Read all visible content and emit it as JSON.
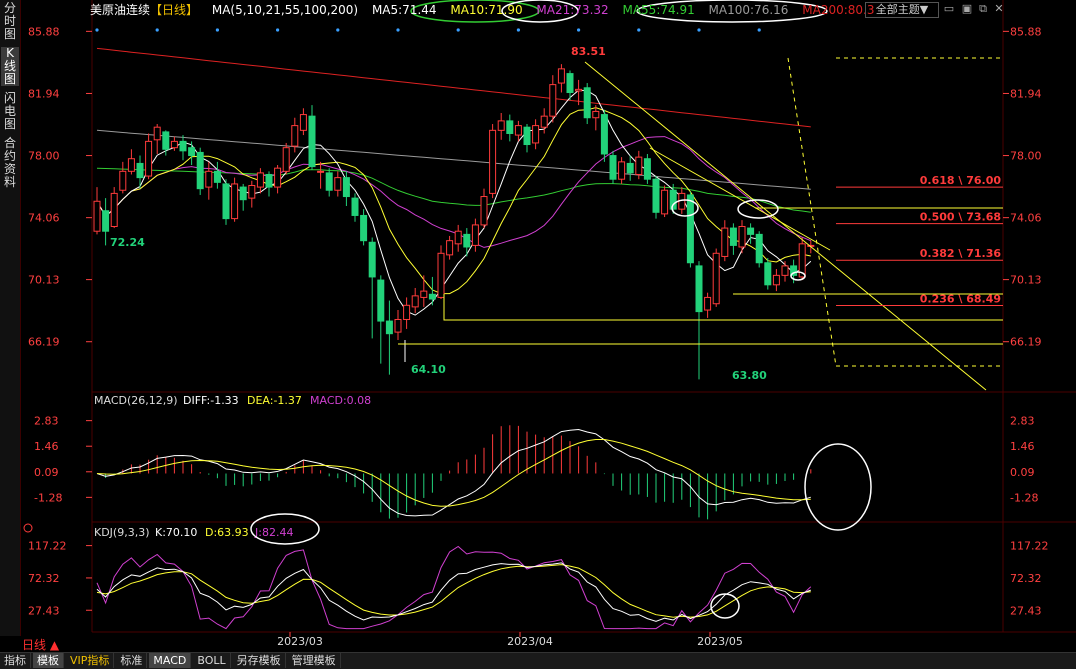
{
  "sidebar": {
    "items": [
      {
        "label": "分时图",
        "active": false
      },
      {
        "label": "K线图",
        "active": true
      },
      {
        "label": "闪电图",
        "active": false
      },
      {
        "label": "合约资料",
        "active": false
      }
    ]
  },
  "header": {
    "title": "美原油连续",
    "period_tag": "【日线】",
    "ma_label": "MA(5,10,21,55,100,200)",
    "ma5": "MA5:71.44",
    "ma10": "MA10:71.90",
    "ma21": "MA21:73.32",
    "ma55": "MA55:74.91",
    "ma100": "MA100:76.16",
    "ma200": "MA200:80.3",
    "theme_select": "全部主题▼"
  },
  "colors": {
    "up": "#ff3b3b",
    "down": "#22d27a",
    "ma5": "#ffffff",
    "ma10": "#ffff33",
    "ma21": "#d040d0",
    "ma55": "#33cc33",
    "ma100": "#9a9a9a",
    "ma200": "#dd2222",
    "axis_red": "#ff4040",
    "grid": "#4a0000"
  },
  "macd": {
    "label": "MACD(26,12,9)",
    "diff": "DIFF:-1.33",
    "dea": "DEA:-1.37",
    "macd": "MACD:0.08",
    "ticks": [
      "2.83",
      "1.46",
      "0.09",
      "-1.28"
    ]
  },
  "kdj": {
    "label": "KDJ(9,3,3)",
    "k": "K:70.10",
    "d": "D:63.93",
    "j": "J:82.44",
    "ticks": [
      "117.22",
      "72.32",
      "27.43"
    ]
  },
  "bottom": {
    "period": "日线 ▲",
    "tabs": [
      "指标",
      "模板",
      "VIP指标",
      "标准",
      "MACD",
      "BOLL",
      "另存模板",
      "管理模板"
    ]
  },
  "chart_data": {
    "type": "candlestick",
    "price_ticks": [
      85.88,
      81.94,
      78.0,
      74.06,
      70.13,
      66.19
    ],
    "ylim": [
      63.0,
      86.6
    ],
    "x_labels": [
      "2023/03",
      "2023/04",
      "2023/05"
    ],
    "annotations": {
      "high": "83.51",
      "low1": "64.10",
      "low2": "63.80",
      "low0": "72.24"
    },
    "fib_levels": [
      {
        "label": "0.618 \\ 76.00",
        "value": 76.0
      },
      {
        "label": "0.500 \\ 73.68",
        "value": 73.68
      },
      {
        "label": "0.382 \\ 71.36",
        "value": 71.36
      },
      {
        "label": "0.236 \\ 68.49",
        "value": 68.49
      }
    ],
    "candles": [
      [
        73.2,
        75.1,
        76.0,
        73.0
      ],
      [
        74.5,
        73.2,
        75.3,
        72.3
      ],
      [
        73.5,
        75.6,
        76.0,
        73.4
      ],
      [
        75.8,
        77.0,
        77.6,
        75.6
      ],
      [
        77.0,
        77.8,
        78.4,
        76.8
      ],
      [
        77.5,
        76.6,
        78.0,
        75.9
      ],
      [
        76.7,
        78.9,
        79.4,
        76.5
      ],
      [
        79.0,
        79.8,
        80.0,
        78.1
      ],
      [
        79.5,
        78.4,
        79.6,
        78.0
      ],
      [
        78.5,
        78.9,
        79.2,
        78.3
      ],
      [
        78.9,
        78.3,
        79.3,
        77.7
      ],
      [
        78.5,
        78.0,
        78.9,
        77.4
      ],
      [
        78.2,
        75.9,
        78.5,
        75.5
      ],
      [
        76.0,
        77.0,
        77.6,
        75.2
      ],
      [
        77.0,
        76.3,
        77.6,
        75.9
      ],
      [
        76.2,
        74.0,
        76.5,
        73.6
      ],
      [
        74.0,
        76.2,
        76.6,
        73.8
      ],
      [
        76.0,
        75.2,
        76.2,
        74.5
      ],
      [
        75.3,
        76.1,
        76.4,
        74.7
      ],
      [
        76.0,
        76.9,
        77.2,
        75.6
      ],
      [
        76.8,
        76.0,
        77.0,
        75.4
      ],
      [
        76.0,
        77.2,
        77.4,
        75.6
      ],
      [
        77.0,
        78.5,
        78.8,
        76.8
      ],
      [
        78.6,
        79.9,
        80.4,
        78.2
      ],
      [
        79.6,
        80.6,
        81.0,
        79.3
      ],
      [
        80.5,
        77.3,
        81.2,
        77.1
      ],
      [
        77.0,
        77.0,
        77.6,
        75.9
      ],
      [
        76.9,
        75.8,
        77.2,
        75.4
      ],
      [
        75.8,
        76.6,
        77.0,
        75.4
      ],
      [
        76.6,
        75.4,
        77.0,
        74.8
      ],
      [
        75.3,
        74.2,
        75.6,
        73.8
      ],
      [
        74.2,
        72.6,
        74.6,
        72.3
      ],
      [
        72.5,
        70.3,
        72.8,
        66.4
      ],
      [
        70.1,
        67.5,
        70.4,
        64.8
      ],
      [
        67.5,
        66.7,
        68.8,
        64.1
      ],
      [
        66.8,
        67.6,
        68.2,
        66.3
      ],
      [
        67.6,
        68.5,
        69.0,
        67.0
      ],
      [
        68.4,
        69.1,
        69.6,
        68.0
      ],
      [
        69.0,
        69.4,
        70.4,
        68.4
      ],
      [
        69.2,
        68.9,
        70.3,
        68.5
      ],
      [
        69.0,
        71.8,
        72.3,
        68.9
      ],
      [
        71.7,
        72.6,
        72.9,
        71.4
      ],
      [
        72.4,
        73.2,
        73.6,
        71.9
      ],
      [
        73.0,
        72.2,
        73.4,
        71.6
      ],
      [
        72.3,
        73.6,
        74.0,
        71.9
      ],
      [
        73.6,
        75.4,
        75.9,
        73.4
      ],
      [
        75.6,
        79.6,
        80.0,
        75.3
      ],
      [
        79.6,
        80.2,
        80.7,
        79.0
      ],
      [
        80.2,
        79.4,
        80.6,
        78.9
      ],
      [
        79.3,
        79.9,
        80.2,
        78.9
      ],
      [
        79.8,
        78.7,
        80.0,
        78.2
      ],
      [
        78.8,
        79.9,
        80.3,
        78.4
      ],
      [
        79.8,
        80.5,
        81.0,
        79.4
      ],
      [
        80.5,
        82.5,
        83.1,
        80.1
      ],
      [
        82.6,
        83.5,
        83.8,
        82.0
      ],
      [
        83.2,
        82.0,
        83.4,
        81.5
      ],
      [
        82.1,
        82.2,
        82.8,
        81.2
      ],
      [
        82.3,
        80.4,
        82.6,
        80.0
      ],
      [
        80.4,
        80.8,
        81.2,
        79.6
      ],
      [
        80.6,
        78.1,
        80.9,
        77.6
      ],
      [
        78.0,
        76.5,
        78.3,
        76.2
      ],
      [
        76.5,
        77.6,
        77.9,
        76.2
      ],
      [
        77.5,
        76.9,
        78.0,
        76.4
      ],
      [
        76.8,
        77.9,
        78.3,
        76.5
      ],
      [
        77.8,
        76.5,
        78.1,
        76.2
      ],
      [
        76.5,
        74.4,
        76.7,
        74.0
      ],
      [
        74.3,
        75.8,
        76.1,
        74.1
      ],
      [
        75.8,
        74.6,
        76.2,
        74.3
      ],
      [
        74.6,
        75.6,
        76.0,
        74.3
      ],
      [
        75.5,
        71.2,
        75.7,
        70.9
      ],
      [
        71.0,
        68.1,
        71.3,
        63.8
      ],
      [
        68.2,
        69.0,
        69.3,
        67.7
      ],
      [
        68.6,
        71.8,
        72.1,
        68.4
      ],
      [
        71.6,
        73.4,
        73.9,
        71.3
      ],
      [
        73.4,
        72.3,
        73.7,
        71.7
      ],
      [
        72.2,
        73.5,
        73.9,
        71.8
      ],
      [
        73.4,
        73.0,
        73.7,
        72.4
      ],
      [
        73.0,
        71.2,
        73.2,
        70.9
      ],
      [
        71.2,
        69.8,
        71.5,
        69.5
      ],
      [
        69.8,
        70.4,
        70.8,
        69.4
      ],
      [
        70.4,
        71.0,
        71.3,
        70.0
      ],
      [
        71.0,
        70.4,
        71.4,
        69.9
      ],
      [
        70.3,
        72.4,
        72.8,
        70.1
      ],
      [
        72.3,
        72.3,
        72.6,
        71.8
      ]
    ]
  }
}
